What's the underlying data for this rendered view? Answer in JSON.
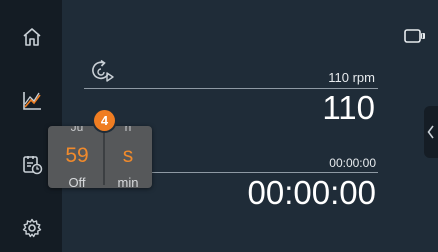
{
  "nav": {
    "items": [
      {
        "name": "home",
        "icon": "home-icon"
      },
      {
        "name": "graph",
        "icon": "graph-icon"
      },
      {
        "name": "program",
        "icon": "program-timer-icon"
      },
      {
        "name": "settings",
        "icon": "gear-icon"
      }
    ]
  },
  "status": {
    "battery_icon": "battery-icon"
  },
  "speed": {
    "setpoint": "110 rpm",
    "value": "110",
    "icon": "rotation-icon"
  },
  "timer": {
    "setpoint": "00:00:00",
    "value": "00:00:00"
  },
  "picker": {
    "badge": "4",
    "left": {
      "above": "Ju",
      "value": "59",
      "below": "Off"
    },
    "right": {
      "above": "h",
      "value": "s",
      "below": "min"
    }
  },
  "colors": {
    "background": "#1f2c38",
    "sidebar": "#141c24",
    "accent": "#ef7d22",
    "picker_value": "#f08a2c"
  }
}
